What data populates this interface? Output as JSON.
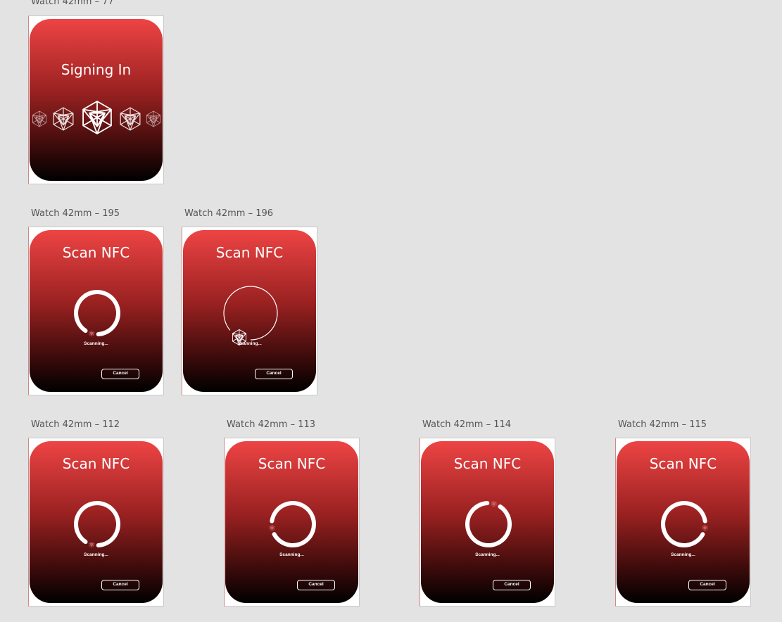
{
  "artboards": {
    "signing_in": {
      "label": "Watch 42mm – 77",
      "title": "Signing In"
    },
    "scan_195": {
      "label": "Watch 42mm – 195",
      "title": "Scan NFC",
      "status": "Scanning...",
      "cancel": "Cancel",
      "ring_style": "thick-arc",
      "dice_angle_deg": 105
    },
    "scan_196": {
      "label": "Watch 42mm – 196",
      "title": "Scan NFC",
      "status": "Scanning...",
      "cancel": "Cancel",
      "ring_style": "thin-arc",
      "dice_angle_deg": 115
    },
    "scan_112": {
      "label": "Watch 42mm – 112",
      "title": "Scan NFC",
      "status": "Scanning...",
      "cancel": "Cancel",
      "ring_style": "thick-arc",
      "dice_angle_deg": 105
    },
    "scan_113": {
      "label": "Watch 42mm – 113",
      "title": "Scan NFC",
      "status": "Scanning...",
      "cancel": "Cancel",
      "ring_style": "thick-arc",
      "dice_angle_deg": 170
    },
    "scan_114": {
      "label": "Watch 42mm – 114",
      "title": "Scan NFC",
      "status": "Scanning...",
      "cancel": "Cancel",
      "ring_style": "thick-arc",
      "dice_angle_deg": -75
    },
    "scan_115": {
      "label": "Watch 42mm – 115",
      "title": "Scan NFC",
      "status": "Scanning...",
      "cancel": "Cancel",
      "ring_style": "thick-arc",
      "dice_angle_deg": 10
    }
  },
  "colors": {
    "canvas_bg": "#e3e3e3",
    "gradient_top": "#ee4444",
    "gradient_bottom": "#000000",
    "foreground": "#ffffff",
    "dice_accent": "#e07a7a"
  },
  "icons": {
    "dice": "d20-icosahedron-icon",
    "ring": "progress-ring-icon"
  }
}
